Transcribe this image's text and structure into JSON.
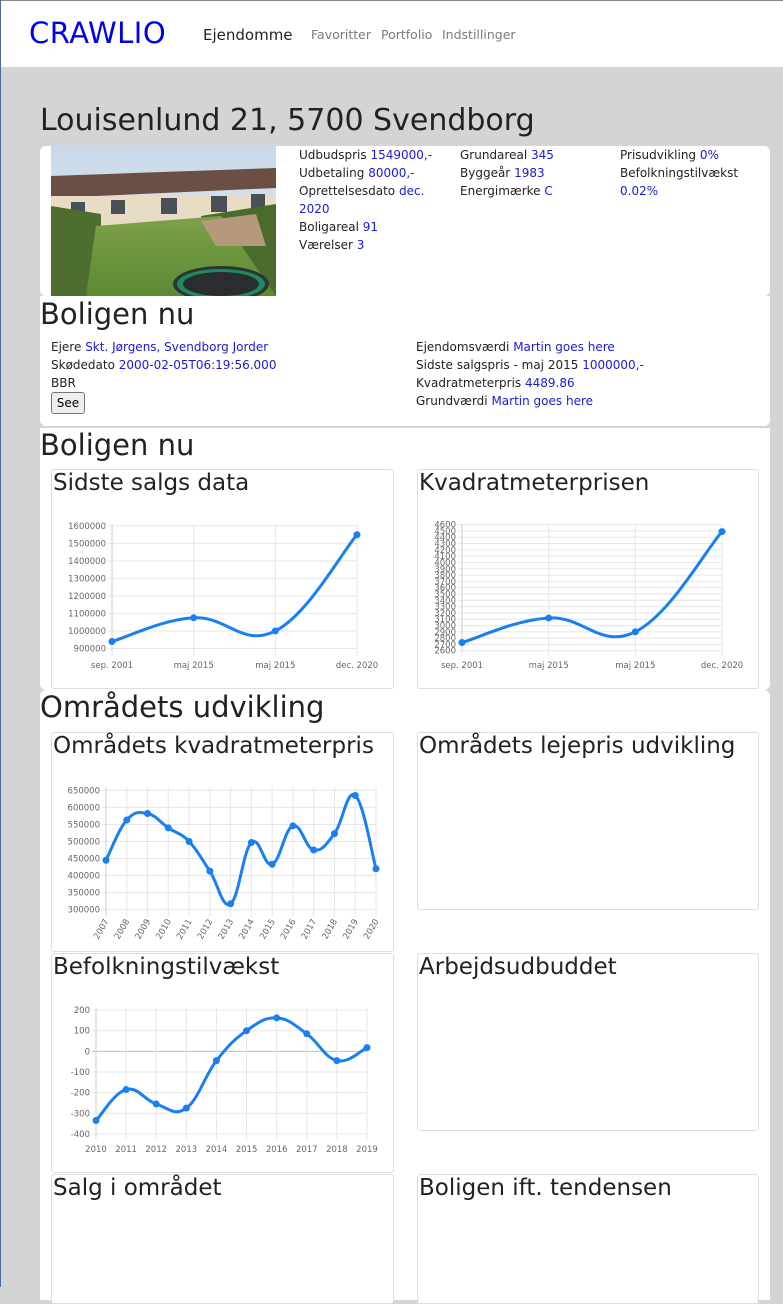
{
  "nav": {
    "brand": "CRAWLIO",
    "active": "Ejendomme",
    "links": [
      "Favoritter",
      "Portfolio",
      "Indstillinger"
    ]
  },
  "property": {
    "title": "Louisenlund 21, 5700 Svendborg",
    "col1": {
      "udbudspris_label": "Udbudspris",
      "udbudspris": "1549000,-",
      "udbetaling_label": "Udbetaling",
      "udbetaling": "80000,-",
      "oprettelse_label": "Oprettelsesdato",
      "oprettelse_a": "dec.",
      "oprettelse_b": "2020",
      "boligareal_label": "Boligareal",
      "boligareal": "91",
      "vaerelser_label": "Værelser",
      "vaerelser": "3"
    },
    "col2": {
      "grundareal_label": "Grundareal",
      "grundareal": "345",
      "byggeaar_label": "Byggeår",
      "byggeaar": "1983",
      "energi_label": "Energimærke",
      "energi": "C"
    },
    "col3": {
      "prisudvikling_label": "Prisudvikling",
      "prisudvikling": "0%",
      "befolkning_label": "Befolkningstilvækst",
      "befolkning": "0.02%"
    }
  },
  "boligen_nu": {
    "title": "Boligen nu",
    "ejere_label": "Ejere",
    "ejere": "Skt. Jørgens, Svendborg Jorder",
    "skoedato_label": "Skødedato",
    "skoedato": "2000-02-05T06:19:56.000",
    "bbr_label": "BBR",
    "see_button": "See",
    "ejendomsvaerdi_label": "Ejendomsværdi",
    "ejendomsvaerdi": "Martin goes here",
    "sidste_salg_label": "Sidste salgspris - maj 2015",
    "sidste_salg": "1000000,-",
    "kvm_label": "Kvadratmeterpris",
    "kvm": "4489.86",
    "grundvaerdi_label": "Grundværdi",
    "grundvaerdi": "Martin goes here"
  },
  "boligen_nu_charts": {
    "title": "Boligen nu",
    "chart1_title": "Sidste salgs data",
    "chart2_title": "Kvadratmeterprisen"
  },
  "omraadet": {
    "title": "Områdets udvikling",
    "c1_title": "Områdets kvadratmeterpris",
    "c2_title": "Områdets lejepris udvikling",
    "c3_title": "Befolkningstilvækst",
    "c4_title": "Arbejdsudbuddet",
    "c5_title": "Salg i området",
    "c6_title": "Boligen ift. tendensen"
  },
  "colors": {
    "accent": "#1a1ad6",
    "line": "#1a7ff0",
    "brand": "#0000ee"
  },
  "chart_data": [
    {
      "id": "sidste-salgs-data",
      "type": "line",
      "categories": [
        "sep. 2001",
        "maj 2015",
        "maj 2015",
        "dec. 2020"
      ],
      "values": [
        940000,
        1075000,
        1000000,
        1549000
      ],
      "yticks": [
        900000,
        1000000,
        1100000,
        1200000,
        1300000,
        1400000,
        1500000,
        1600000
      ],
      "ylim": [
        880000,
        1610000
      ],
      "grid": true
    },
    {
      "id": "kvadratmeterprisen",
      "type": "line",
      "categories": [
        "sep. 2001",
        "maj 2015",
        "maj 2015",
        "dec. 2020"
      ],
      "values": [
        2730,
        3120,
        2900,
        4490
      ],
      "yticks": [
        2600,
        2700,
        2800,
        2900,
        3000,
        3100,
        3200,
        3300,
        3400,
        3500,
        3600,
        3700,
        3800,
        3900,
        4000,
        4100,
        4200,
        4300,
        4400,
        4500,
        4600
      ],
      "ylim": [
        2580,
        4610
      ],
      "grid": true
    },
    {
      "id": "omraadets-kvadratmeterpris",
      "type": "line",
      "categories": [
        "2007",
        "2008",
        "2009",
        "2010",
        "2011",
        "2012",
        "2013",
        "2014",
        "2015",
        "2016",
        "2017",
        "2018",
        "2019",
        "2020"
      ],
      "values": [
        445000,
        563000,
        582000,
        540000,
        500000,
        413000,
        317000,
        497000,
        433000,
        546000,
        475000,
        523000,
        635000,
        420000
      ],
      "yticks": [
        300000,
        350000,
        400000,
        450000,
        500000,
        550000,
        600000,
        650000
      ],
      "ylim": [
        290000,
        660000
      ],
      "grid": true,
      "rotated_xticks": true
    },
    {
      "id": "befolkningstilvaekst",
      "type": "line",
      "categories": [
        "2010",
        "2011",
        "2012",
        "2013",
        "2014",
        "2015",
        "2016",
        "2017",
        "2018",
        "2019"
      ],
      "values": [
        -335,
        -185,
        -255,
        -275,
        -45,
        100,
        162,
        85,
        -45,
        18
      ],
      "yticks": [
        -400,
        -300,
        -200,
        -100,
        0,
        100,
        200
      ],
      "ylim": [
        -410,
        210
      ],
      "grid": true
    }
  ]
}
